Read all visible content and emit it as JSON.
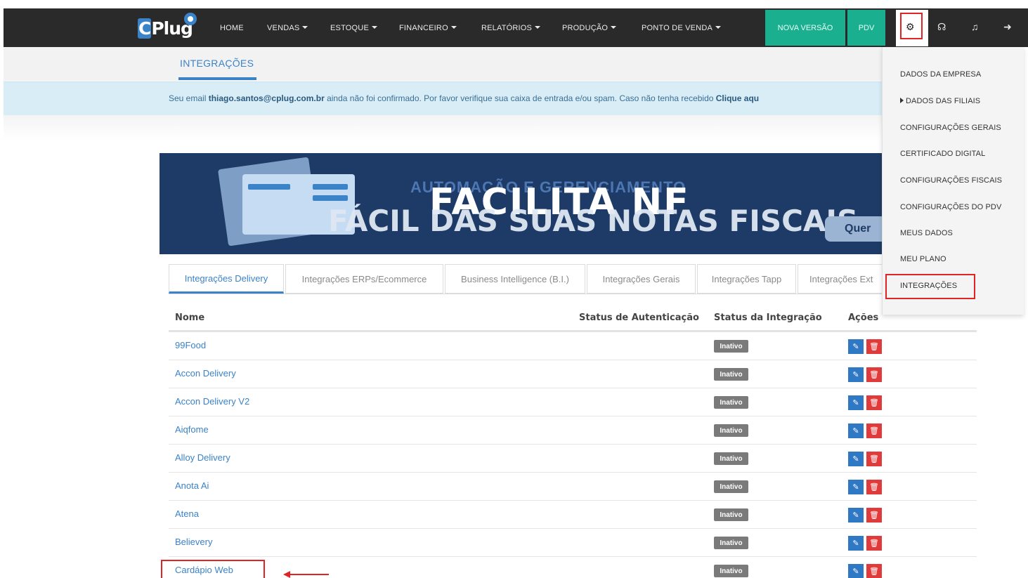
{
  "navbar": {
    "logo_text": "CPlug",
    "items": [
      {
        "label": "HOME",
        "caret": false
      },
      {
        "label": "VENDAS",
        "caret": true
      },
      {
        "label": "ESTOQUE",
        "caret": true
      },
      {
        "label": "FINANCEIRO",
        "caret": true
      },
      {
        "label": "RELATÓRIOS",
        "caret": true
      },
      {
        "label": "PRODUÇÃO",
        "caret": true
      },
      {
        "label": "PONTO DE VENDA",
        "caret": true
      }
    ],
    "nova_versao": "NOVA VERSÃO",
    "pdv": "PDV",
    "icons": [
      "gear-icon",
      "headset-icon",
      "bell-icon",
      "logout-icon"
    ]
  },
  "subnav": {
    "active_tab": "INTEGRAÇÕES"
  },
  "alert": {
    "prefix": "Seu email ",
    "email": "thiago.santos@cplug.com.br",
    "suffix": " ainda não foi confirmado. Por favor verifique sua caixa de entrada e/ou spam. Caso não tenha recebido ",
    "link": "Clique aqu"
  },
  "banner": {
    "line1": "AUTOMAÇÃO E GERENCIAMENTO",
    "line2": "FACILITA NF",
    "line3": "FÁCIL DAS SUAS NOTAS FISCAIS",
    "button": "Quer"
  },
  "tabs": [
    {
      "label": "Integrações Delivery",
      "active": true
    },
    {
      "label": "Integrações ERPs/Ecommerce",
      "active": false
    },
    {
      "label": "Business Intelligence (B.I.)",
      "active": false
    },
    {
      "label": "Integrações Gerais",
      "active": false
    },
    {
      "label": "Integrações Tapp",
      "active": false
    },
    {
      "label": "Integrações Ext",
      "active": false
    }
  ],
  "table": {
    "headers": {
      "nome": "Nome",
      "auth": "Status de Autenticação",
      "status": "Status da Integração",
      "acoes": "Ações"
    },
    "rows": [
      {
        "name": "99Food",
        "status": "Inativo"
      },
      {
        "name": "Accon Delivery",
        "status": "Inativo"
      },
      {
        "name": "Accon Delivery V2",
        "status": "Inativo"
      },
      {
        "name": "Aiqfome",
        "status": "Inativo"
      },
      {
        "name": "Alloy Delivery",
        "status": "Inativo"
      },
      {
        "name": "Anota Ai",
        "status": "Inativo"
      },
      {
        "name": "Atena",
        "status": "Inativo"
      },
      {
        "name": "Believery",
        "status": "Inativo"
      },
      {
        "name": "Cardápio Web",
        "status": "Inativo"
      }
    ]
  },
  "dropdown": {
    "items": [
      {
        "label": "DADOS DA EMPRESA",
        "caret": false
      },
      {
        "label": "DADOS DAS FILIAIS",
        "caret": true
      },
      {
        "label": "CONFIGURAÇÕES GERAIS",
        "caret": false
      },
      {
        "label": "CERTIFICADO DIGITAL",
        "caret": false
      },
      {
        "label": "CONFIGURAÇÕES FISCAIS",
        "caret": false
      },
      {
        "label": "CONFIGURAÇÕES DO PDV",
        "caret": false
      },
      {
        "label": "MEUS DADOS",
        "caret": false
      },
      {
        "label": "MEU PLANO",
        "caret": false
      },
      {
        "label": "INTEGRAÇÕES",
        "caret": false
      }
    ]
  },
  "colors": {
    "accent": "#3b83c8",
    "navbar": "#2a2a2a",
    "green": "#1aaf8f",
    "highlight": "#e02424",
    "badge": "#7a7a7a"
  }
}
